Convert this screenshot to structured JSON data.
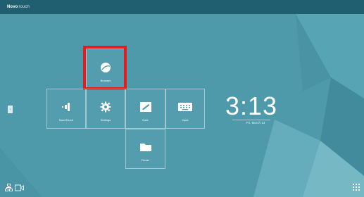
{
  "header": {
    "brand_bold": "Novo",
    "brand_light": "Touch"
  },
  "apps": {
    "browser": "Browser",
    "novotouch": "NovoTouch",
    "settings": "Settings",
    "note": "Note",
    "input": "Input",
    "finder": "Finder"
  },
  "clock": {
    "time": "3:13",
    "date": "Fri. March 13"
  },
  "colors": {
    "topbar": "#1f5f70",
    "background": "#4e9aab",
    "highlight": "#e31d1d"
  },
  "icons": {
    "browser": "globe-icon",
    "novotouch": "novotouch-icon",
    "settings": "gear-icon",
    "note": "note-edit-icon",
    "input": "keyboard-input-icon",
    "finder": "folder-icon",
    "side": "chevron-right-icon",
    "bottom_left": [
      "network-icon",
      "camera-icon"
    ],
    "bottom_right": "app-grid-icon"
  }
}
